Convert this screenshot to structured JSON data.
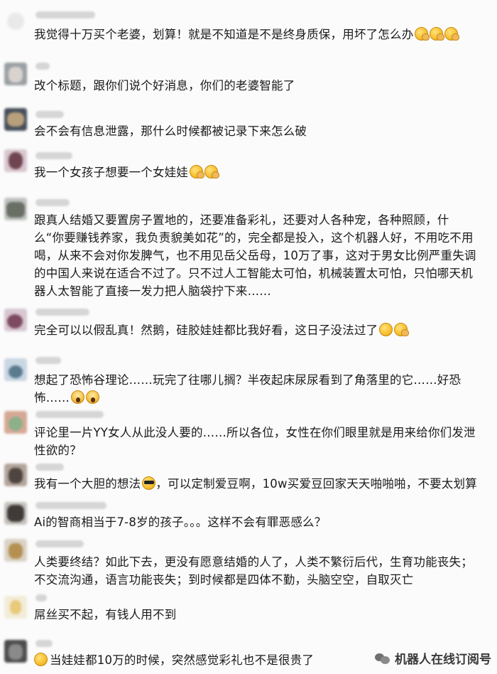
{
  "comments": [
    {
      "text": "我觉得十万买个老婆，划算！就是不知道是不是终身质保，用坏了怎么办",
      "emojis": [
        "facepalm",
        "facepalm",
        "facepalm"
      ]
    },
    {
      "text": "改个标题，跟你们说个好消息，你们的老婆智能了",
      "emojis": []
    },
    {
      "text": "会不会有信息泄露，那什么时候都被记录下来怎么破",
      "emojis": []
    },
    {
      "text": "我一个女孩子想要一个女娃娃",
      "emojis": [
        "facepalm",
        "facepalm"
      ]
    },
    {
      "text": "跟真人结婚又要置房子置地的，还要准备彩礼，还要对人各种宠，各种照顾，什么“你要赚钱养家，我负责貌美如花”的，完全都是投入，这个机器人好，不用吃不用喝，从来不会对你发脾气，也不用见岳父岳母，10万了事，这对于男女比例严重失调的中国人来说在适合不过了。只不过人工智能太可怕，机械装置太可怕，只怕哪天机器人太智能了直接一发力把人脑袋拧下来……",
      "emojis": []
    },
    {
      "text": "完全可以以假乱真！然鹅，硅胶娃娃都比我好看，这日子没法过了",
      "emojis": [
        "smile",
        "facepalm"
      ]
    },
    {
      "text": "想起了恐怖谷理论……玩完了往哪儿搁？半夜起床尿尿看到了角落里的它……好恐怖……",
      "emojis": [
        "scream",
        "scream"
      ]
    },
    {
      "text": "评论里一片YY女人从此没人要的……所以各位，女性在你们眼里就是用来给你们发泄性欲的？",
      "emojis": []
    },
    {
      "text": "我有一个大胆的想法",
      "emojis": [
        "cool"
      ],
      "text_after": "，可以定制爱豆啊，10w买爱豆回家天天啪啪啪，不要太划算"
    },
    {
      "text": "Ai的智商相当于7-8岁的孩子。。。这样不会有罪恶感么？",
      "emojis": []
    },
    {
      "text": "人类要终结？如此下去，更没有愿意结婚的人了，人类不繁衍后代，生育功能丧失；不交流沟通，语言功能丧失；到时候都是四体不勤，头脑空空，自取灭亡",
      "emojis": []
    },
    {
      "text": "屌丝买不起，有钱人用不到",
      "emojis": []
    },
    {
      "text": "当娃娃都10万的时候，突然感觉彩礼也不是很贵了",
      "emojis": [],
      "lead_emoji": "smile"
    }
  ],
  "watermark": {
    "text": "机器人在线订阅号",
    "icon": "wechat-icon"
  }
}
